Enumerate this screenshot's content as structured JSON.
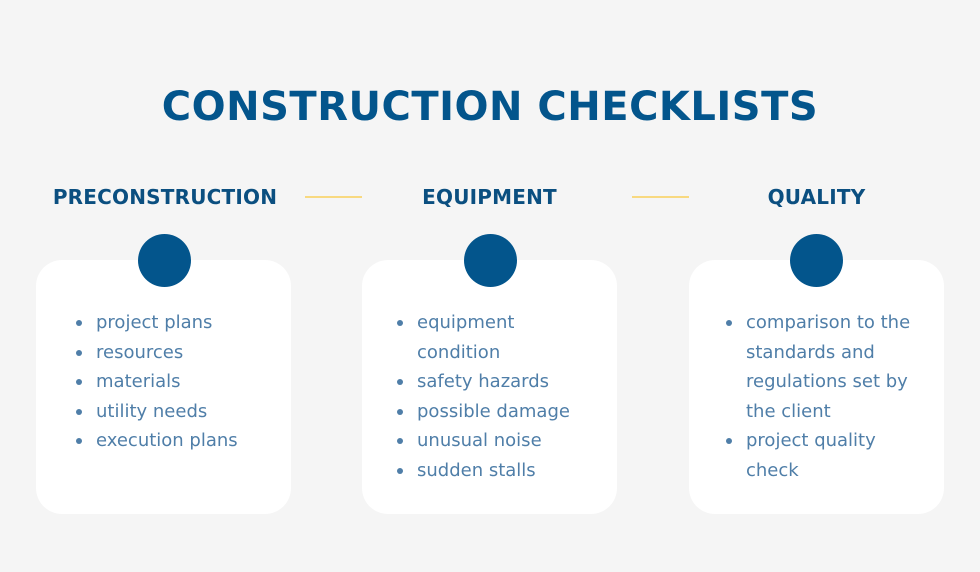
{
  "title": "CONSTRUCTION CHECKLISTS",
  "colors": {
    "primary": "#03558c",
    "heading": "#0b4f80",
    "text": "#4f7ea8",
    "connector": "#f8d980",
    "background": "#f5f5f5",
    "card": "#ffffff"
  },
  "columns": [
    {
      "heading": "PRECONSTRUCTION",
      "items": [
        "project plans",
        "resources",
        "materials",
        "utility needs",
        "execution plans"
      ]
    },
    {
      "heading": "EQUIPMENT",
      "items": [
        "equipment condition",
        "safety hazards",
        "possible damage",
        "unusual noise",
        "sudden stalls"
      ]
    },
    {
      "heading": "QUALITY",
      "items": [
        "comparison to the standards and regulations set by the client",
        "project quality check"
      ]
    }
  ]
}
